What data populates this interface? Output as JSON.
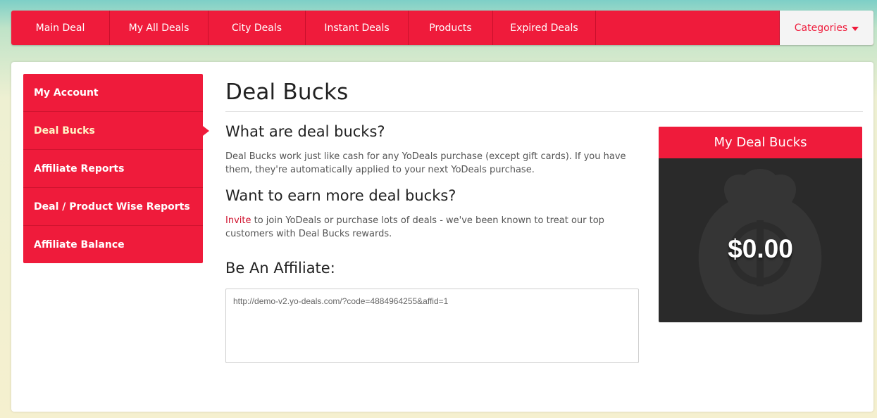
{
  "nav": {
    "items": [
      {
        "label": "Main Deal"
      },
      {
        "label": "My All Deals"
      },
      {
        "label": "City Deals"
      },
      {
        "label": "Instant Deals"
      },
      {
        "label": "Products"
      },
      {
        "label": "Expired Deals"
      }
    ],
    "categories_label": "Categories"
  },
  "sidebar": {
    "items": [
      {
        "label": "My Account"
      },
      {
        "label": "Deal Bucks"
      },
      {
        "label": "Affiliate Reports"
      },
      {
        "label": "Deal / Product Wise Reports"
      },
      {
        "label": "Affiliate Balance"
      }
    ],
    "active_index": 1
  },
  "main": {
    "title": "Deal Bucks",
    "what_heading": "What are deal bucks?",
    "what_text": "Deal Bucks work just like cash for any YoDeals purchase (except gift cards). If you have them, they're automatically applied to your next YoDeals purchase.",
    "earn_heading": "Want to earn more deal bucks?",
    "invite_link": "Invite",
    "earn_text": " to join YoDeals or purchase lots of deals - we've been known to treat our top customers with Deal Bucks rewards.",
    "affiliate_heading": "Be An Affiliate:",
    "affiliate_url": "http://demo-v2.yo-deals.com/?code=4884964255&affid=1"
  },
  "widget": {
    "title": "My Deal Bucks",
    "amount": "$0.00",
    "icon": "money-bag-icon"
  },
  "colors": {
    "brand_red": "#ef1b3b",
    "widget_dark": "#2a2a2a",
    "active_text": "#fff6c7"
  }
}
